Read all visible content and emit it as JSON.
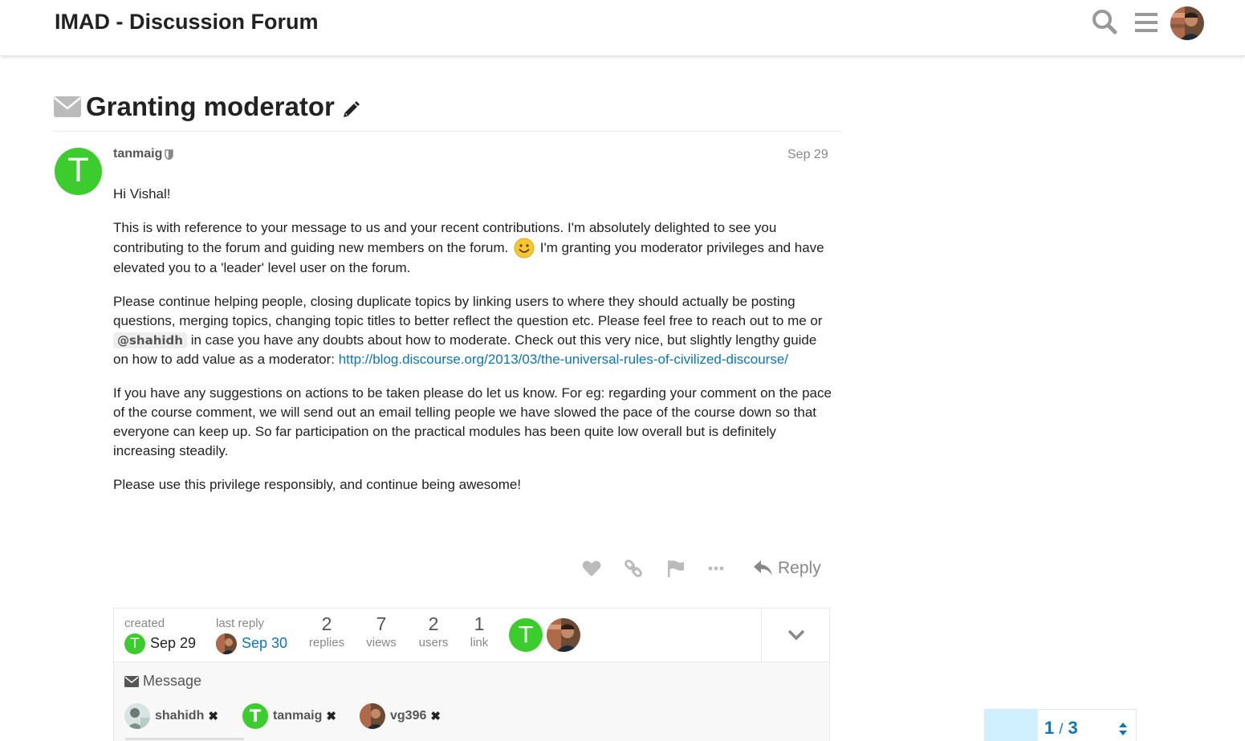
{
  "header": {
    "site_title": "IMAD - Discussion Forum"
  },
  "topic": {
    "title": "Granting moderator"
  },
  "post": {
    "avatar_letter": "T",
    "username": "tanmaig",
    "date": "Sep 29",
    "greeting": "Hi Vishal!",
    "p1_a": "This is with reference to your message to us and your recent contributions. I'm absolutely delighted to see you contributing to the forum and guiding new members on the forum.",
    "p1_b": "I'm granting you moderator privileges and have elevated you to a 'leader' level user on the forum.",
    "p2_a": "Please continue helping people, closing duplicate topics by linking users to where they should actually be posting questions, merging topics, changing topic titles to better reflect the question etc. Please feel free to reach out to me or",
    "p2_mention": "@shahidh",
    "p2_b": "in case you have any doubts about how to moderate. Check out this very nice, but slightly lengthy guide on how to add value as a moderator:",
    "p2_link": "http://blog.discourse.org/2013/03/the-universal-rules-of-civilized-discourse/",
    "p3": "If you have any suggestions on actions to be taken please do let us know. For eg: regarding your comment on the pace of the course comment, we will send out an email telling people we have slowed the pace of the course down so that everyone can keep up. So far participation on the practical modules has been quite low overall but is definitely increasing steadily.",
    "p4": "Please use this privilege responsibly, and continue being awesome!",
    "reply_label": "Reply"
  },
  "topic_map": {
    "created_label": "created",
    "created_date": "Sep 29",
    "created_avatar_letter": "T",
    "last_reply_label": "last reply",
    "last_reply_date": "Sep 30",
    "stats": [
      {
        "num": "2",
        "label": "replies"
      },
      {
        "num": "7",
        "label": "views"
      },
      {
        "num": "2",
        "label": "users"
      },
      {
        "num": "1",
        "label": "link"
      }
    ],
    "poster_letter": "T",
    "message_label": "Message",
    "participants": [
      {
        "name": "shahidh",
        "remove": "✖"
      },
      {
        "name": "tanmaig",
        "letter": "T",
        "remove": "✖"
      },
      {
        "name": "vg396",
        "remove": "✖"
      }
    ]
  },
  "timeline": {
    "current": "1",
    "separator": "/",
    "total": "3"
  },
  "colors": {
    "accent": "#0a76bd",
    "avatar_green": "#3dcc2e",
    "muted": "#888888"
  }
}
